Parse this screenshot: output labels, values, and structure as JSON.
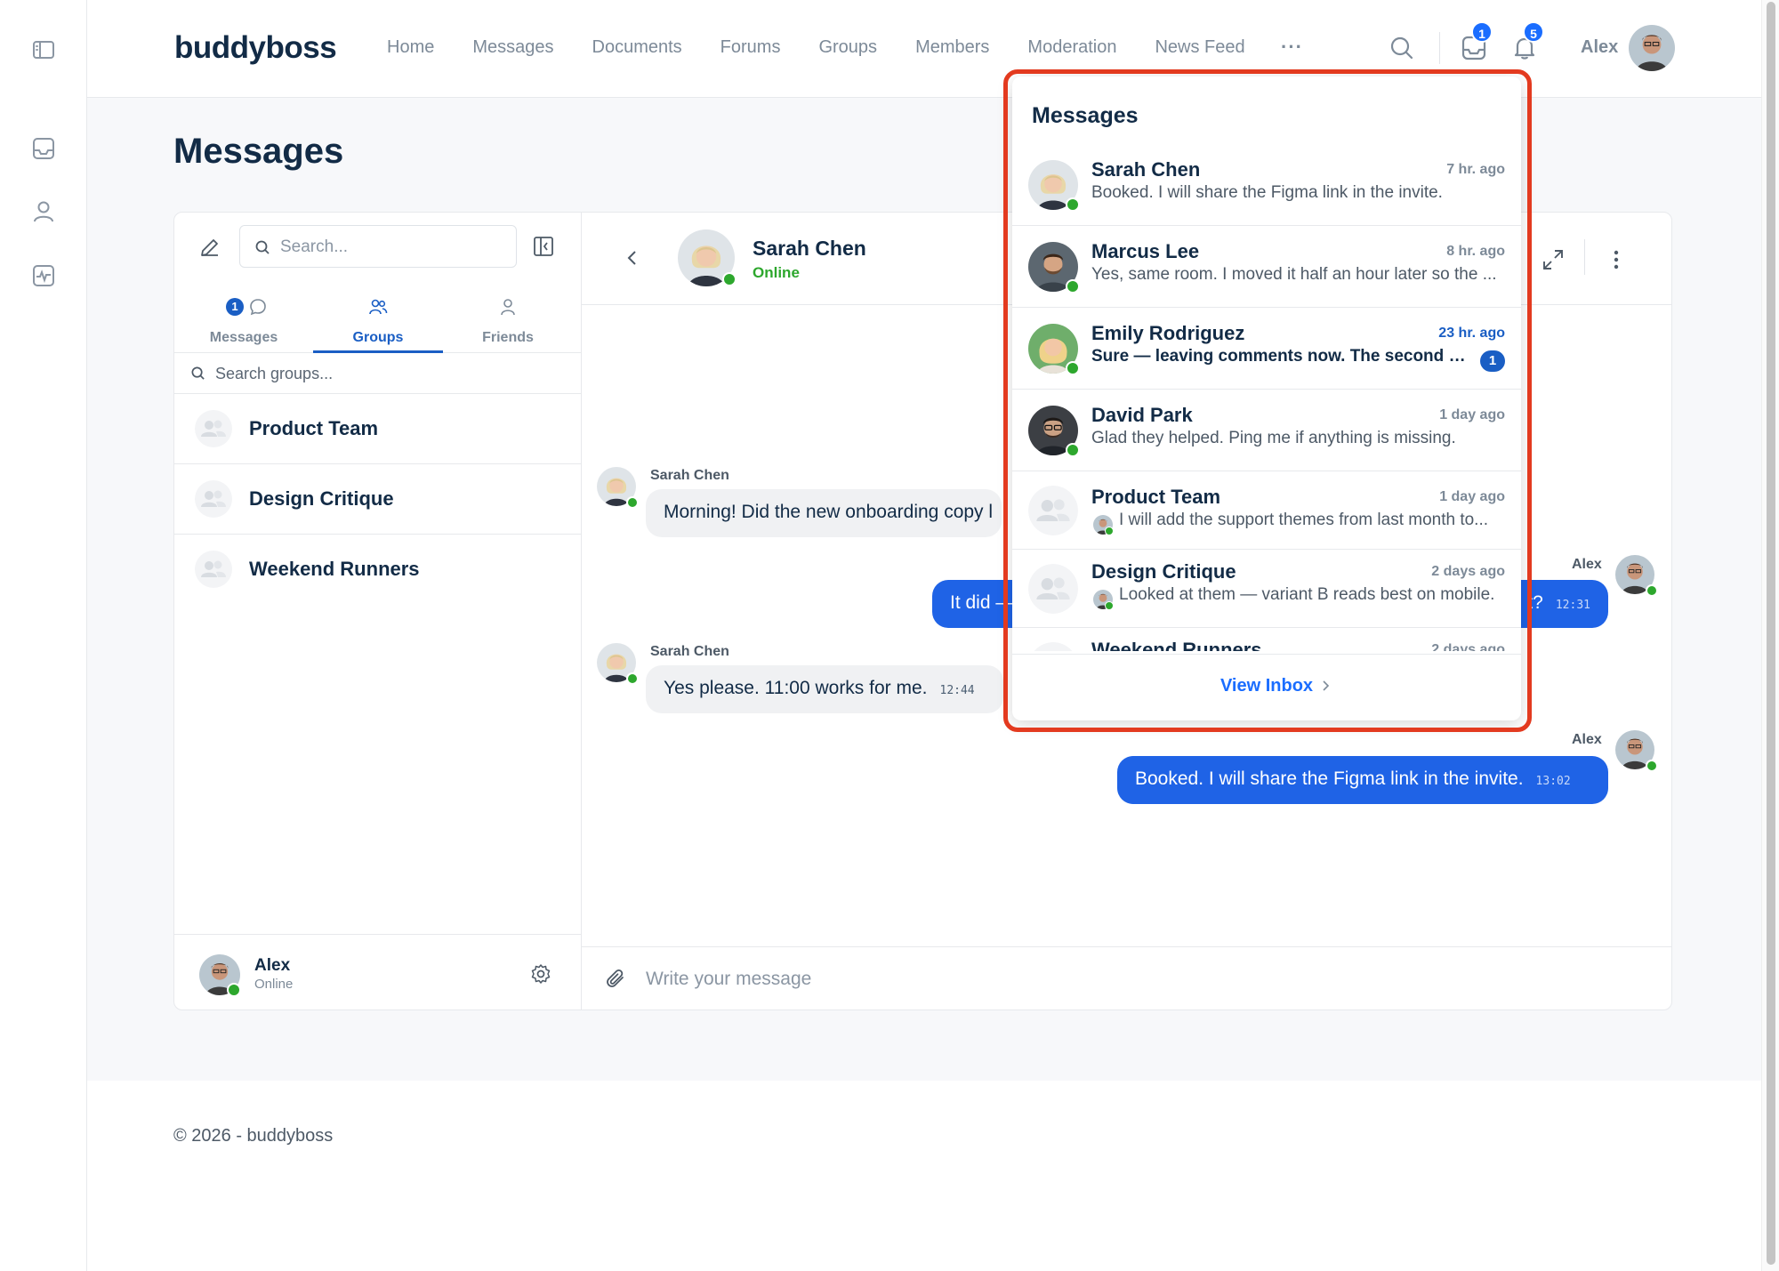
{
  "app": {
    "logo": "buddyboss"
  },
  "nav": {
    "items": [
      "Home",
      "Messages",
      "Documents",
      "Forums",
      "Groups",
      "Members",
      "Moderation",
      "News Feed"
    ],
    "more": "···"
  },
  "header": {
    "inbox_count": "1",
    "notifications_count": "5",
    "user_name": "Alex"
  },
  "page": {
    "title": "Messages"
  },
  "sidebar": {
    "search_placeholder": "Search...",
    "tabs": [
      {
        "label": "Messages",
        "badge": "1"
      },
      {
        "label": "Groups",
        "active": true
      },
      {
        "label": "Friends"
      }
    ],
    "search_groups_placeholder": "Search groups...",
    "groups": [
      "Product Team",
      "Design Critique",
      "Weekend Runners"
    ],
    "footer_user": {
      "name": "Alex",
      "status": "Online"
    }
  },
  "conversation": {
    "contact_name": "Sarah Chen",
    "contact_status": "Online",
    "messages": [
      {
        "sender": "Sarah Chen",
        "text": "Morning! Did the new onboarding copy l",
        "time": ""
      },
      {
        "sender": "Alex",
        "text": "It did — ",
        "tail": "t?",
        "time": "12:31"
      },
      {
        "sender": "Sarah Chen",
        "text": "Yes please. 11:00 works for me.",
        "time": "12:44"
      },
      {
        "sender": "Alex",
        "text": "Booked. I will share the Figma link in the invite.",
        "time": "13:02"
      }
    ],
    "composer_placeholder": "Write your message"
  },
  "dropdown": {
    "title": "Messages",
    "items": [
      {
        "name": "Sarah Chen",
        "time": "7 hr. ago",
        "preview": "Booked. I will share the Figma link in the invite.",
        "unread": false
      },
      {
        "name": "Marcus Lee",
        "time": "8 hr. ago",
        "preview": "Yes, same room. I moved it half an hour later so the ...",
        "unread": false
      },
      {
        "name": "Emily Rodriguez",
        "time": "23 hr. ago",
        "preview": "Sure — leaving comments now. The second pa...",
        "unread": true,
        "unread_count": "1"
      },
      {
        "name": "David Park",
        "time": "1 day ago",
        "preview": "Glad they helped. Ping me if anything is missing.",
        "unread": false
      },
      {
        "name": "Product Team",
        "time": "1 day ago",
        "preview": "I will add the support themes from last month to...",
        "unread": false
      },
      {
        "name": "Design Critique",
        "time": "2 days ago",
        "preview": "Looked at them — variant B reads best on mobile.",
        "unread": false
      },
      {
        "name": "Weekend Runners",
        "time": "2 days ago",
        "preview": "",
        "unread": false
      }
    ],
    "view_inbox": "View Inbox"
  },
  "footer": {
    "copyright": "© 2026 - buddyboss"
  },
  "colors": {
    "accent": "#1a5ec4",
    "bubble_out": "#1f63e6",
    "online": "#2da72d",
    "highlight": "#e33a1f"
  },
  "icons": [
    "sidebar-toggle-icon",
    "inbox-icon",
    "profile-icon",
    "activity-icon",
    "search-icon",
    "bell-icon",
    "compose-icon",
    "collapse-icon",
    "chat-icon",
    "groups-icon",
    "friends-icon",
    "gear-icon",
    "back-icon",
    "expand-icon",
    "more-vertical-icon",
    "paperclip-icon",
    "emoji-icon",
    "send-icon",
    "chevron-right-icon"
  ]
}
